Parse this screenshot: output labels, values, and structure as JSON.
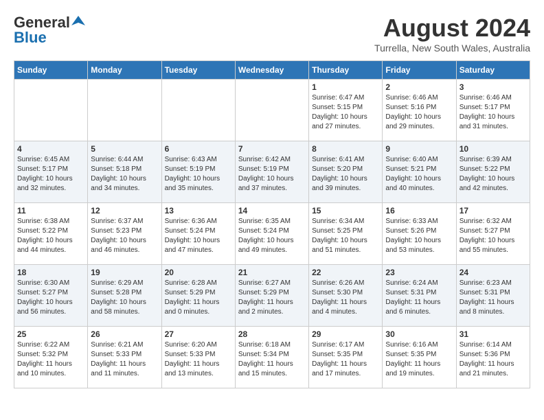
{
  "logo": {
    "line1": "General",
    "line2": "Blue"
  },
  "title": "August 2024",
  "location": "Turrella, New South Wales, Australia",
  "days_of_week": [
    "Sunday",
    "Monday",
    "Tuesday",
    "Wednesday",
    "Thursday",
    "Friday",
    "Saturday"
  ],
  "weeks": [
    [
      {
        "day": "",
        "sunrise": "",
        "sunset": "",
        "daylight": ""
      },
      {
        "day": "",
        "sunrise": "",
        "sunset": "",
        "daylight": ""
      },
      {
        "day": "",
        "sunrise": "",
        "sunset": "",
        "daylight": ""
      },
      {
        "day": "",
        "sunrise": "",
        "sunset": "",
        "daylight": ""
      },
      {
        "day": "1",
        "sunrise": "Sunrise: 6:47 AM",
        "sunset": "Sunset: 5:15 PM",
        "daylight": "Daylight: 10 hours and 27 minutes."
      },
      {
        "day": "2",
        "sunrise": "Sunrise: 6:46 AM",
        "sunset": "Sunset: 5:16 PM",
        "daylight": "Daylight: 10 hours and 29 minutes."
      },
      {
        "day": "3",
        "sunrise": "Sunrise: 6:46 AM",
        "sunset": "Sunset: 5:17 PM",
        "daylight": "Daylight: 10 hours and 31 minutes."
      }
    ],
    [
      {
        "day": "4",
        "sunrise": "Sunrise: 6:45 AM",
        "sunset": "Sunset: 5:17 PM",
        "daylight": "Daylight: 10 hours and 32 minutes."
      },
      {
        "day": "5",
        "sunrise": "Sunrise: 6:44 AM",
        "sunset": "Sunset: 5:18 PM",
        "daylight": "Daylight: 10 hours and 34 minutes."
      },
      {
        "day": "6",
        "sunrise": "Sunrise: 6:43 AM",
        "sunset": "Sunset: 5:19 PM",
        "daylight": "Daylight: 10 hours and 35 minutes."
      },
      {
        "day": "7",
        "sunrise": "Sunrise: 6:42 AM",
        "sunset": "Sunset: 5:19 PM",
        "daylight": "Daylight: 10 hours and 37 minutes."
      },
      {
        "day": "8",
        "sunrise": "Sunrise: 6:41 AM",
        "sunset": "Sunset: 5:20 PM",
        "daylight": "Daylight: 10 hours and 39 minutes."
      },
      {
        "day": "9",
        "sunrise": "Sunrise: 6:40 AM",
        "sunset": "Sunset: 5:21 PM",
        "daylight": "Daylight: 10 hours and 40 minutes."
      },
      {
        "day": "10",
        "sunrise": "Sunrise: 6:39 AM",
        "sunset": "Sunset: 5:22 PM",
        "daylight": "Daylight: 10 hours and 42 minutes."
      }
    ],
    [
      {
        "day": "11",
        "sunrise": "Sunrise: 6:38 AM",
        "sunset": "Sunset: 5:22 PM",
        "daylight": "Daylight: 10 hours and 44 minutes."
      },
      {
        "day": "12",
        "sunrise": "Sunrise: 6:37 AM",
        "sunset": "Sunset: 5:23 PM",
        "daylight": "Daylight: 10 hours and 46 minutes."
      },
      {
        "day": "13",
        "sunrise": "Sunrise: 6:36 AM",
        "sunset": "Sunset: 5:24 PM",
        "daylight": "Daylight: 10 hours and 47 minutes."
      },
      {
        "day": "14",
        "sunrise": "Sunrise: 6:35 AM",
        "sunset": "Sunset: 5:24 PM",
        "daylight": "Daylight: 10 hours and 49 minutes."
      },
      {
        "day": "15",
        "sunrise": "Sunrise: 6:34 AM",
        "sunset": "Sunset: 5:25 PM",
        "daylight": "Daylight: 10 hours and 51 minutes."
      },
      {
        "day": "16",
        "sunrise": "Sunrise: 6:33 AM",
        "sunset": "Sunset: 5:26 PM",
        "daylight": "Daylight: 10 hours and 53 minutes."
      },
      {
        "day": "17",
        "sunrise": "Sunrise: 6:32 AM",
        "sunset": "Sunset: 5:27 PM",
        "daylight": "Daylight: 10 hours and 55 minutes."
      }
    ],
    [
      {
        "day": "18",
        "sunrise": "Sunrise: 6:30 AM",
        "sunset": "Sunset: 5:27 PM",
        "daylight": "Daylight: 10 hours and 56 minutes."
      },
      {
        "day": "19",
        "sunrise": "Sunrise: 6:29 AM",
        "sunset": "Sunset: 5:28 PM",
        "daylight": "Daylight: 10 hours and 58 minutes."
      },
      {
        "day": "20",
        "sunrise": "Sunrise: 6:28 AM",
        "sunset": "Sunset: 5:29 PM",
        "daylight": "Daylight: 11 hours and 0 minutes."
      },
      {
        "day": "21",
        "sunrise": "Sunrise: 6:27 AM",
        "sunset": "Sunset: 5:29 PM",
        "daylight": "Daylight: 11 hours and 2 minutes."
      },
      {
        "day": "22",
        "sunrise": "Sunrise: 6:26 AM",
        "sunset": "Sunset: 5:30 PM",
        "daylight": "Daylight: 11 hours and 4 minutes."
      },
      {
        "day": "23",
        "sunrise": "Sunrise: 6:24 AM",
        "sunset": "Sunset: 5:31 PM",
        "daylight": "Daylight: 11 hours and 6 minutes."
      },
      {
        "day": "24",
        "sunrise": "Sunrise: 6:23 AM",
        "sunset": "Sunset: 5:31 PM",
        "daylight": "Daylight: 11 hours and 8 minutes."
      }
    ],
    [
      {
        "day": "25",
        "sunrise": "Sunrise: 6:22 AM",
        "sunset": "Sunset: 5:32 PM",
        "daylight": "Daylight: 11 hours and 10 minutes."
      },
      {
        "day": "26",
        "sunrise": "Sunrise: 6:21 AM",
        "sunset": "Sunset: 5:33 PM",
        "daylight": "Daylight: 11 hours and 11 minutes."
      },
      {
        "day": "27",
        "sunrise": "Sunrise: 6:20 AM",
        "sunset": "Sunset: 5:33 PM",
        "daylight": "Daylight: 11 hours and 13 minutes."
      },
      {
        "day": "28",
        "sunrise": "Sunrise: 6:18 AM",
        "sunset": "Sunset: 5:34 PM",
        "daylight": "Daylight: 11 hours and 15 minutes."
      },
      {
        "day": "29",
        "sunrise": "Sunrise: 6:17 AM",
        "sunset": "Sunset: 5:35 PM",
        "daylight": "Daylight: 11 hours and 17 minutes."
      },
      {
        "day": "30",
        "sunrise": "Sunrise: 6:16 AM",
        "sunset": "Sunset: 5:35 PM",
        "daylight": "Daylight: 11 hours and 19 minutes."
      },
      {
        "day": "31",
        "sunrise": "Sunrise: 6:14 AM",
        "sunset": "Sunset: 5:36 PM",
        "daylight": "Daylight: 11 hours and 21 minutes."
      }
    ]
  ]
}
